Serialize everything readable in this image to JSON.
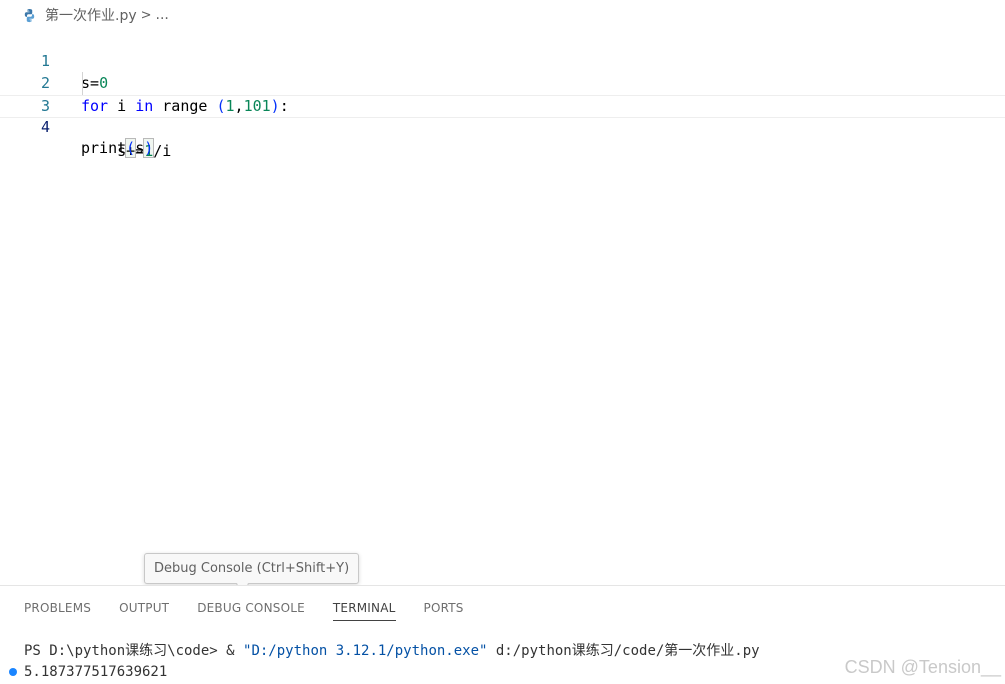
{
  "breadcrumb": {
    "file_icon": "python-icon",
    "filename": "第一次作业.py",
    "separator": ">",
    "more": "..."
  },
  "editor": {
    "lines": [
      {
        "number": "1",
        "tokens": [
          "s=",
          "0"
        ]
      },
      {
        "number": "2",
        "tokens": [
          "for",
          " i ",
          "in",
          " range ",
          "(",
          "1",
          ",",
          "101",
          ")",
          ":"
        ]
      },
      {
        "number": "3",
        "tokens": [
          "    s+=",
          "1",
          "/i"
        ]
      },
      {
        "number": "4",
        "tokens": [
          "print",
          "(",
          "s",
          ")"
        ]
      }
    ]
  },
  "tooltip": {
    "text": "Debug Console (Ctrl+Shift+Y)"
  },
  "panel": {
    "tabs": [
      "PROBLEMS",
      "OUTPUT",
      "DEBUG CONSOLE",
      "TERMINAL",
      "PORTS"
    ],
    "active_tab": "TERMINAL"
  },
  "terminal": {
    "prompt": "PS D:\\python课练习\\code> ",
    "amp": "& ",
    "exe_path": "\"D:/python 3.12.1/python.exe\"",
    "script_path": " d:/python课练习/code/第一次作业.py",
    "output": "5.187377517639621"
  },
  "watermark": "CSDN @Tension__",
  "colors": {
    "keyword": "#0000ff",
    "number": "#098658",
    "line_number": "#237893",
    "terminal_string": "#0451a5",
    "status_dot": "#1a85ff"
  }
}
